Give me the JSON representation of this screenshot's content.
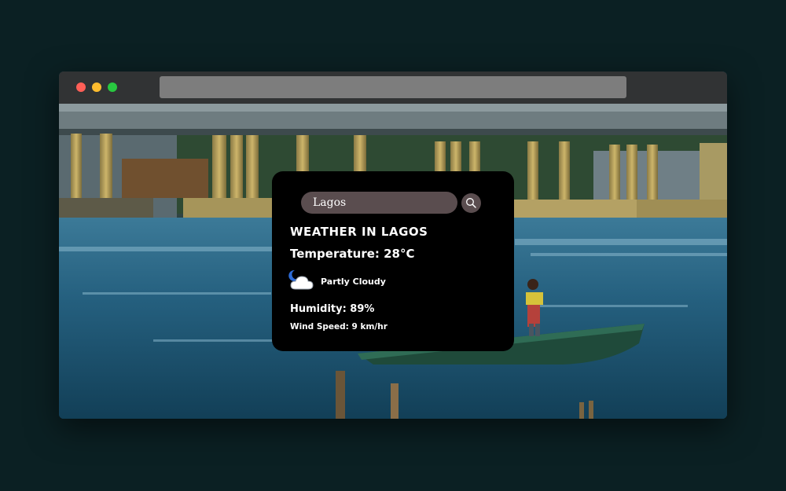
{
  "search": {
    "value": "Lagos",
    "icon": "search-icon"
  },
  "weather": {
    "heading": "Weather in Lagos",
    "temperature": "Temperature: 28°C",
    "condition": "Partly Cloudy",
    "condition_icon": "partly-cloudy-night-icon",
    "humidity": "Humidity: 89%",
    "wind": "Wind Speed: 9 km/hr"
  },
  "colors": {
    "page_background": "#0b2023",
    "card_background": "#000000",
    "search_field": "#5a4d4f",
    "close_dot": "#ff5f57",
    "minimize_dot": "#febc2e",
    "zoom_dot": "#28c840"
  }
}
